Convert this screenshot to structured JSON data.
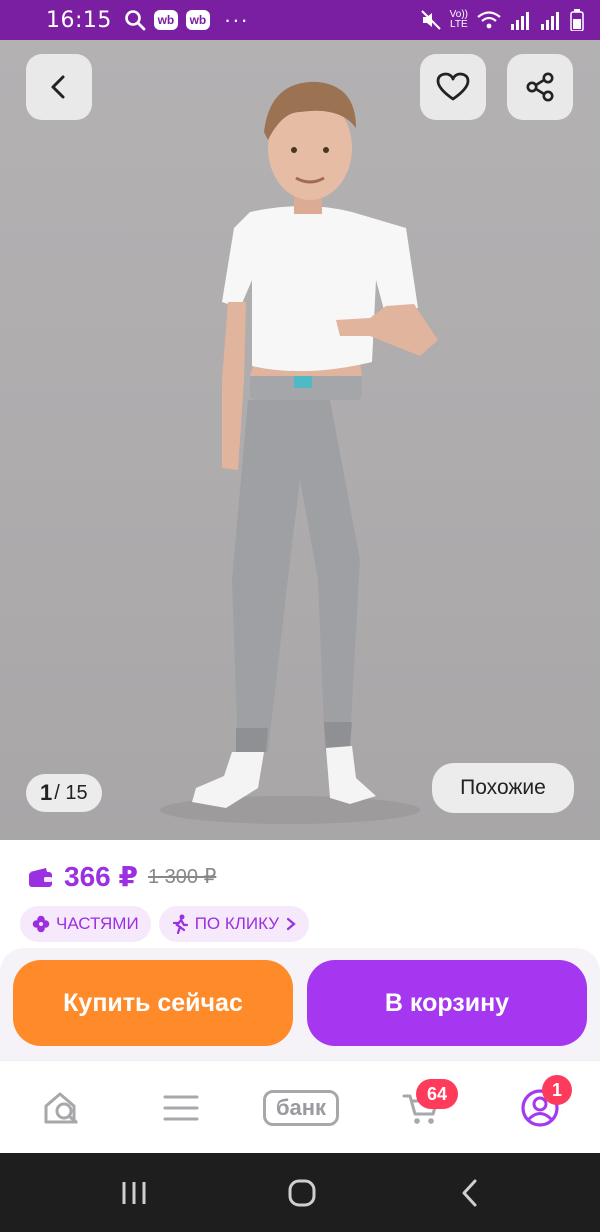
{
  "status_bar": {
    "time": "16:15",
    "badge1": "wb",
    "badge2": "wb",
    "more": "···",
    "volte_top": "Vo))",
    "volte_bottom": "LTE",
    "bg_color": "#7b1fa2"
  },
  "gallery": {
    "current": "1",
    "total": "/ 15",
    "similar_label": "Похожие",
    "icons": [
      "back-arrow-icon",
      "heart-icon",
      "share-icon"
    ]
  },
  "product": {
    "price": "366 ₽",
    "old_price": "1 300 ₽",
    "chips": [
      {
        "label": "ЧАСТЯМИ",
        "icon": "flower-icon"
      },
      {
        "label": "ПО КЛИКУ",
        "icon": "runner-icon"
      }
    ],
    "price_color": "#9b30e0"
  },
  "actions": {
    "buy_now": "Купить сейчас",
    "add_to_cart": "В корзину",
    "buy_color": "#ff8a2a",
    "cart_color": "#a637f0"
  },
  "tabbar": {
    "bank_label": "банк",
    "cart_badge": "64",
    "profile_badge": "1",
    "icons": [
      "home-search-icon",
      "menu-icon",
      "bank-icon",
      "cart-icon",
      "profile-icon"
    ]
  }
}
